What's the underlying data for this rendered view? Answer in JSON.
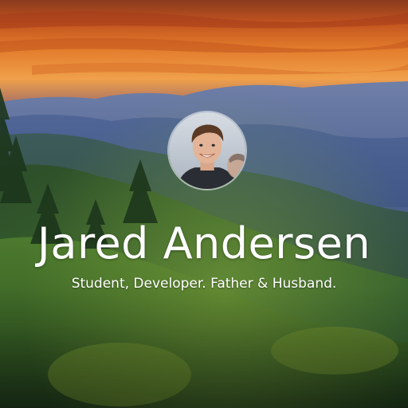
{
  "profile": {
    "name": "Jared Andersen",
    "tagline": "Student, Developer. Father & Husband."
  },
  "background": {
    "subject": "mountain-sunset-landscape",
    "sky_colors": [
      "#b5451b",
      "#e37a2a",
      "#f2a14a",
      "#6b4a66"
    ],
    "mountain_colors": [
      "#5a6c96",
      "#4b5f8c",
      "#3f5580"
    ],
    "forest_colors": [
      "#2f5a2a",
      "#3f6b2c",
      "#58802f",
      "#1f3b1f"
    ]
  },
  "avatar": {
    "subject": "portrait-photo"
  }
}
